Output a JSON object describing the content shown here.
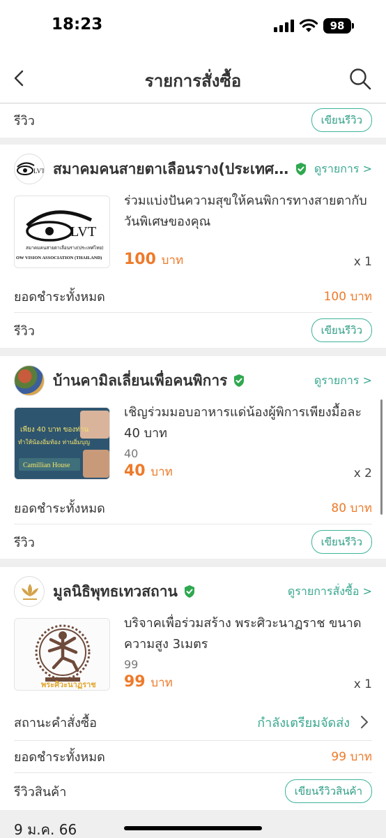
{
  "status": {
    "time": "18:23",
    "battery": "98"
  },
  "nav": {
    "title": "รายการสั่งซื้อ"
  },
  "top_card": {
    "review_label": "รีวิว",
    "review_button": "เขียนรีวิว"
  },
  "orders": [
    {
      "shop_name": "สมาคมคนสายตาเลือนราง(ประเทศ...",
      "view_link": "ดูรายการ >",
      "logo_text": "LVT",
      "logo_sub_th": "สมาคมคนสายตาเลือนราง(ประเทศไทย)",
      "logo_sub_en": "OW VISION ASSOCIATION (THAILAND)",
      "product_title": "ร่วมแบ่งปันความสุขให้คนพิการทางสายตากับวันพิเศษของคุณ",
      "price": "100",
      "unit": "บาท",
      "qty": "x 1",
      "total_label": "ยอดชำระทั้งหมด",
      "total_value": "100 บาท",
      "review_label": "รีวิว",
      "review_button": "เขียนรีวิว"
    },
    {
      "shop_name": "บ้านคามิลเลี่ยนเพื่อคนพิการ",
      "view_link": "ดูรายการ >",
      "image_text_1": "เพียง 40 บาท ของท่าน",
      "image_text_2": "ทำให้น้องอิ่มท้อง ท่านอิ่มบุญ",
      "image_text_3": "Camillian House",
      "product_title": "เชิญร่วมมอบอาหารแด่น้องผู้พิการเพียงมื้อละ 40 บาท",
      "orig_price": "40",
      "price": "40",
      "unit": "บาท",
      "qty": "x 2",
      "total_label": "ยอดชำระทั้งหมด",
      "total_value": "80 บาท",
      "review_label": "รีวิว",
      "review_button": "เขียนรีวิว"
    },
    {
      "shop_name": "มูลนิธิพุทธเทวสถาน",
      "view_link": "ดูรายการสั่งซื้อ >",
      "image_caption": "พระศิวะนาฏราช",
      "product_title": "บริจาคเพื่อร่วมสร้าง พระศิวะนาฏราช ขนาดความสูง 3เมตร",
      "orig_price": "99",
      "price": "99",
      "unit": "บาท",
      "qty": "x 1",
      "status_label": "สถานะคำสั่งซื้อ",
      "status_value": "กำลังเตรียมจัดส่ง",
      "total_label": "ยอดชำระทั้งหมด",
      "total_value": "99 บาท",
      "review_label": "รีวิวสินค้า",
      "review_button": "เขียนรีวิวสินค้า"
    }
  ],
  "date_header": "9 ม.ค. 66",
  "colors": {
    "accent": "#3aa88f",
    "price": "#ee7a2a",
    "verified": "#2fa84f"
  }
}
